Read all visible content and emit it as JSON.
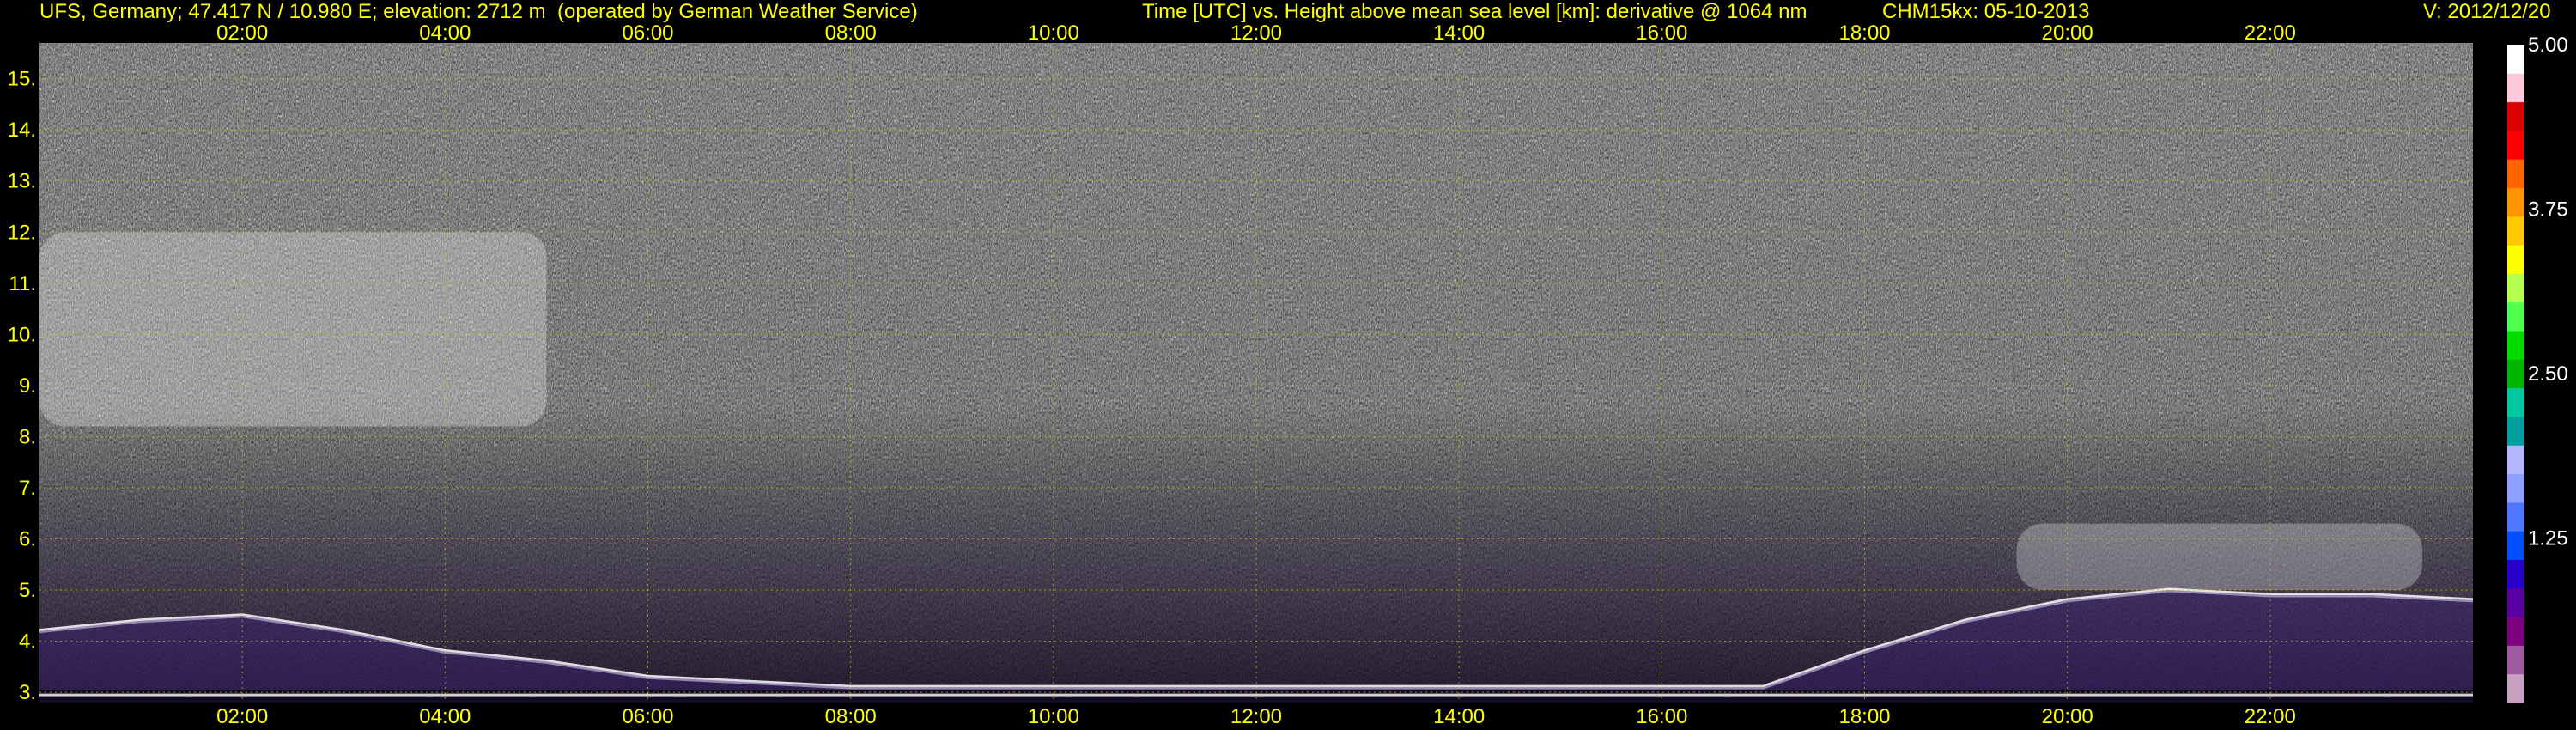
{
  "header": {
    "station": "UFS, Germany; 47.417 N / 10.980 E; elevation: 2712 m  (operated by German Weather Service)",
    "axes": "Time [UTC] vs. Height above mean sea level [km]: derivative @ 1064 nm",
    "instrument": "CHM15kx: 05-10-2013",
    "version": "V: 2012/12/20"
  },
  "chart_data": {
    "type": "heatmap",
    "title": "Time [UTC] vs. Height above mean sea level [km]: derivative @ 1064 nm",
    "x": {
      "unit": "UTC",
      "range": [
        "00:00",
        "24:00"
      ],
      "ticks": [
        "02:00",
        "04:00",
        "06:00",
        "08:00",
        "10:00",
        "12:00",
        "14:00",
        "16:00",
        "18:00",
        "20:00",
        "22:00"
      ]
    },
    "y": {
      "unit": "km",
      "range": [
        2.8,
        15.7
      ],
      "ticks": [
        "3.",
        "4.",
        "5.",
        "6.",
        "7.",
        "8.",
        "9.",
        "10.",
        "11.",
        "12.",
        "13.",
        "14.",
        "15."
      ]
    },
    "colorbar": {
      "range": [
        0,
        5.0
      ],
      "ticks": [
        "1.25",
        "2.50",
        "3.75",
        "5.00"
      ],
      "colors": [
        "#c8a0c0",
        "#a05aa0",
        "#800080",
        "#5a00a0",
        "#2800c8",
        "#0050ff",
        "#5078ff",
        "#8ca0ff",
        "#b4b4ff",
        "#00a0a0",
        "#00c8a0",
        "#00b400",
        "#00dc00",
        "#50ff50",
        "#b4ff50",
        "#ffff00",
        "#ffc800",
        "#ff9600",
        "#ff6400",
        "#ff0000",
        "#dc0000",
        "#ffc8dc",
        "#ffffff"
      ]
    },
    "grid": true,
    "features": [
      {
        "label": "cirrus layer",
        "t_start": 0.0,
        "t_end": 5.0,
        "h_bottom": 8.2,
        "h_top": 12.0
      },
      {
        "label": "boundary layer top",
        "t_start": 0.0,
        "t_end": 24.0,
        "h_values": [
          4.2,
          4.4,
          4.5,
          4.2,
          3.8,
          3.6,
          3.3,
          3.2,
          3.1,
          3.1,
          3.1,
          3.1,
          3.1,
          3.1,
          3.1,
          3.1,
          3.1,
          3.1,
          3.8,
          4.4,
          4.8,
          5.0,
          4.9,
          4.9,
          4.8
        ]
      },
      {
        "label": "cloud layer",
        "t_start": 19.5,
        "t_end": 23.5,
        "h_bottom": 5.0,
        "h_top": 6.3
      }
    ]
  }
}
